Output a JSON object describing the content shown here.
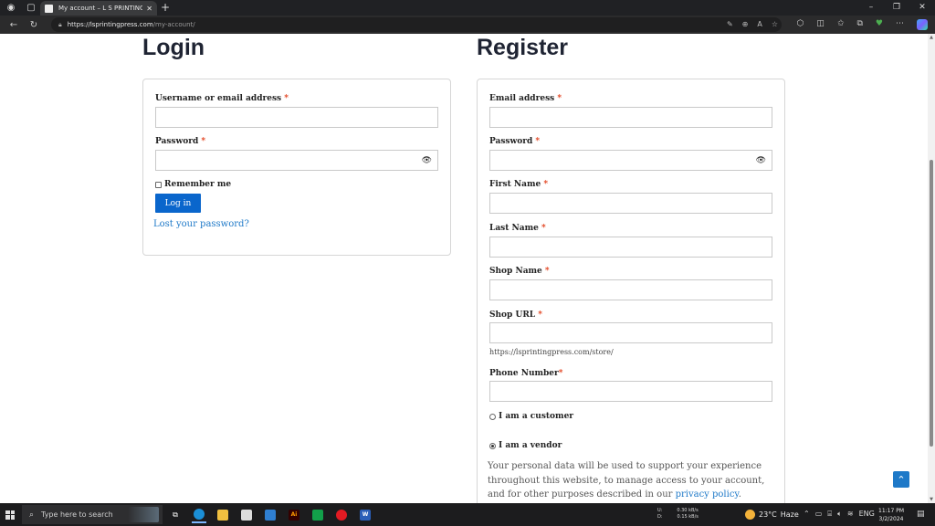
{
  "browser": {
    "tab_title": "My account – L S PRINTING PRESS",
    "url_host": "https://lsprintingpress.com",
    "url_path": "/my-account/"
  },
  "login": {
    "heading": "Login",
    "username_label": "Username or email address",
    "password_label": "Password",
    "required_mark": "*",
    "remember_label": "Remember me",
    "login_button": "Log in",
    "lost_password": "Lost your password?"
  },
  "register": {
    "heading": "Register",
    "email_label": "Email address",
    "password_label": "Password",
    "first_name_label": "First Name",
    "last_name_label": "Last Name",
    "shop_name_label": "Shop Name",
    "shop_url_label": "Shop URL",
    "shop_url_hint": "https://lsprintingpress.com/store/",
    "phone_label": "Phone Number",
    "required_mark": "*",
    "customer_option": "I am a customer",
    "vendor_option": "I am a vendor",
    "selected_role": "vendor",
    "privacy_text": "Your personal data will be used to support your experience throughout this website, to manage access to your account, and for other purposes described in our ",
    "privacy_link": "privacy policy",
    "privacy_end": "."
  },
  "taskbar": {
    "search_placeholder": "Type here to search",
    "net_up_label": "U:",
    "net_up_value": "0.30 kB/s",
    "net_down_label": "D:",
    "net_down_value": "0.15 kB/s",
    "temperature": "23°C",
    "weather": "Haze",
    "language": "ENG",
    "time": "11:17 PM",
    "date": "3/2/2024"
  },
  "colors": {
    "primary": "#0a66cc",
    "link": "#1e79c8",
    "required": "#e2401c",
    "heading": "#1f2433"
  }
}
